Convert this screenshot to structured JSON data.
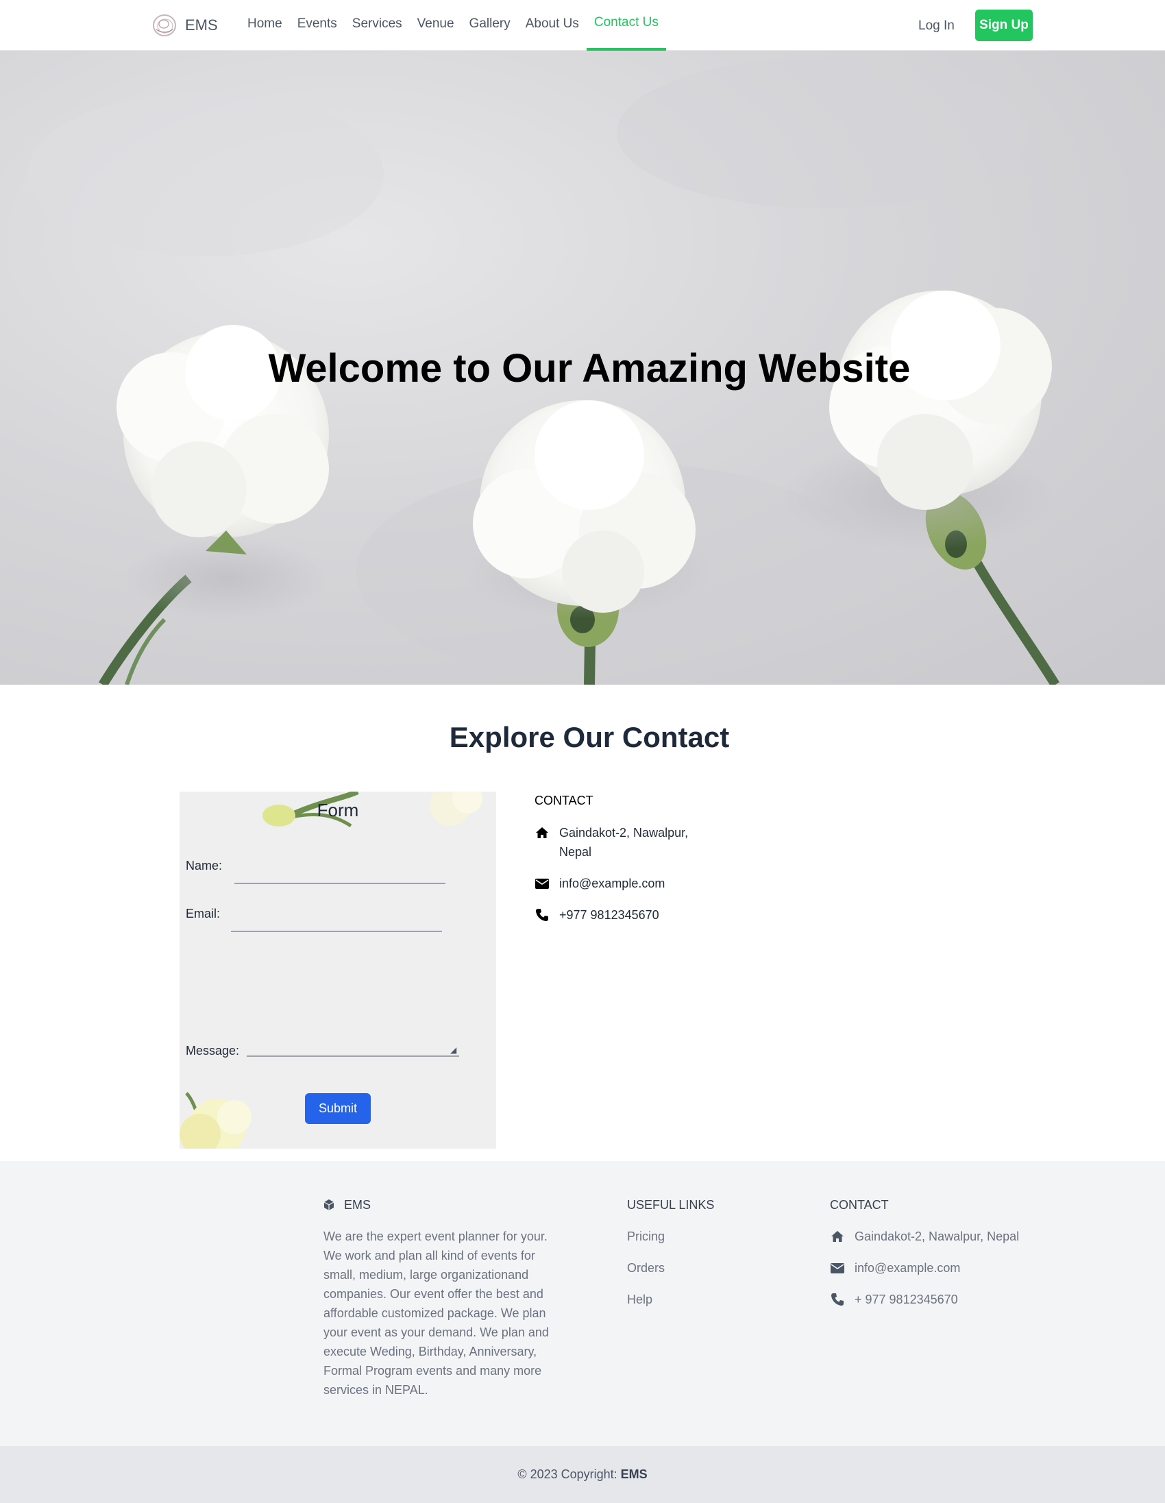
{
  "nav": {
    "brand": "EMS",
    "links": [
      "Home",
      "Events",
      "Services",
      "Venue",
      "Gallery",
      "About Us",
      "Contact Us"
    ],
    "active": "Contact Us",
    "login_label": "Log In",
    "signup_label": "Sign Up",
    "accent_color": "#22c55e"
  },
  "hero": {
    "title": "Welcome to Our Amazing Website"
  },
  "contact_section": {
    "title": "Explore Our Contact",
    "form": {
      "title": "Form",
      "name_label": "Name:",
      "email_label": "Email:",
      "message_label": "Message:",
      "submit_label": "Submit",
      "submit_color": "#2563eb"
    },
    "info": {
      "heading": "CONTACT",
      "address_line1": "Gaindakot-2, Nawalpur,",
      "address_line2": "Nepal",
      "email": "info@example.com",
      "phone": "+977 9812345670"
    }
  },
  "footer": {
    "brand": "EMS",
    "about": "We are the expert event planner for your. We work and plan all kind of events for small, medium, large organizationand companies. Our event offer the best and affordable customized package. We plan your event as your demand. We plan and execute Weding, Birthday, Anniversary, Formal Program events and many more services in NEPAL.",
    "links_heading": "USEFUL LINKS",
    "links": [
      "Pricing",
      "Orders",
      "Help"
    ],
    "contact_heading": "CONTACT",
    "address": "Gaindakot-2, Nawalpur, Nepal",
    "email": "info@example.com",
    "phone": "+ 977 9812345670",
    "copyright_prefix": "© 2023 Copyright:",
    "copyright_brand": "EMS"
  }
}
